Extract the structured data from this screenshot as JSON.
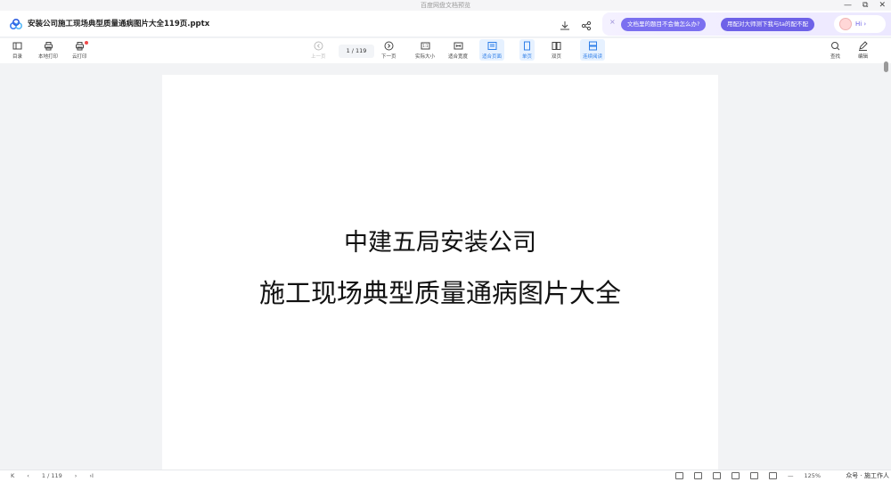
{
  "window": {
    "title": "百度网盘文档预览",
    "controls": [
      "—",
      "⧉",
      "✕"
    ]
  },
  "tab": {
    "doc_title": "安装公司施工现场典型质量通病图片大全119页.pptx"
  },
  "assistant": {
    "close": "×",
    "pill1": "文档里的题目不会做怎么办?",
    "pill2": "用配对大师测下我与ta的配不配",
    "hi": "Hi ›"
  },
  "toolbar": {
    "toc": "目录",
    "local_print": "本地打印",
    "cloud_print": "云打印",
    "prev": "上一页",
    "page_indicator": "1 / 119",
    "next": "下一页",
    "actual_size": "实际大小",
    "fit_width": "适合宽度",
    "fit_page": "适合页面",
    "single": "单页",
    "double": "双页",
    "continuous": "连续阅读",
    "find": "查找",
    "edit": "编辑"
  },
  "document": {
    "line1": "中建五局安装公司",
    "line2": "施工现场典型质量通病图片大全"
  },
  "status": {
    "first": "K",
    "prev": "‹",
    "page": "1 / 119",
    "next": "›",
    "last": "›I",
    "zoom_out": "—",
    "zoom": "125%",
    "watermark": "众号 · 施工作人"
  },
  "colors": {
    "accent": "#2f7fe8",
    "assistant": "#7b70f0"
  }
}
